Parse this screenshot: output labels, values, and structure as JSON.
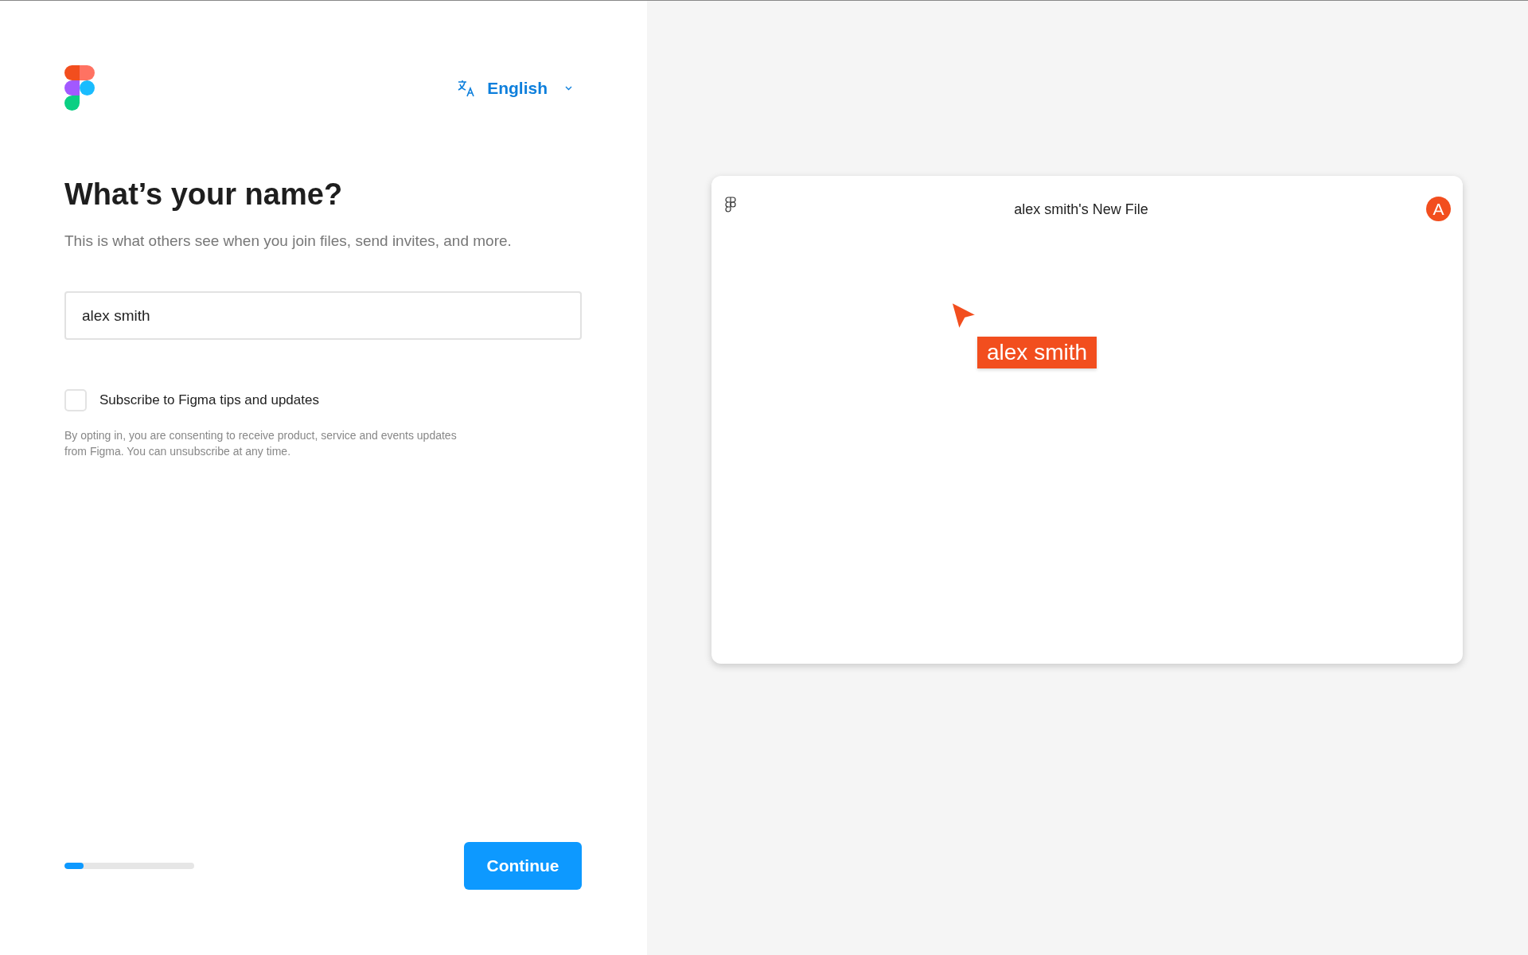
{
  "language": {
    "label": "English"
  },
  "heading": "What’s your name?",
  "subtitle": "This is what others see when you join files, send invites, and more.",
  "name_field": {
    "value": "alex smith"
  },
  "subscribe": {
    "label": "Subscribe to Figma tips and updates",
    "checked": false
  },
  "consent_note": "By opting in, you are consenting to receive product, service and events updates from Figma. You can unsubscribe at any time.",
  "progress": {
    "level": 0.15
  },
  "continue_button": "Continue",
  "preview": {
    "file_title": "alex smith's New File",
    "avatar": "A",
    "cursor_label": "alex smith"
  }
}
